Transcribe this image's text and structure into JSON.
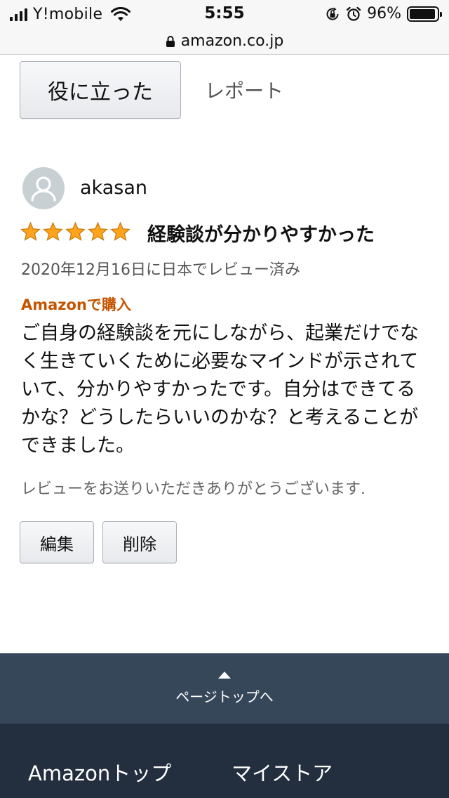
{
  "status_bar": {
    "carrier": "Y!mobile",
    "time": "5:55",
    "battery_percent": "96%",
    "battery_level": 0.96,
    "icons": [
      "signal-icon",
      "wifi-icon",
      "orientation-lock-icon",
      "alarm-icon",
      "battery-icon"
    ]
  },
  "browser": {
    "url": "amazon.co.jp",
    "icons": [
      "lock-icon"
    ]
  },
  "helpful": {
    "button_label": "役に立った",
    "report_label": "レポート"
  },
  "review": {
    "reviewer": "akasan",
    "rating": 5,
    "rating_max": 5,
    "title": "経験談が分かりやすかった",
    "date": "2020年12月16日に日本でレビュー済み",
    "verified": "Amazonで購入",
    "body": "ご自身の経験談を元にしながら、起業だけでなく生きていくために必要なマインドが示されていて、分かりやすかったです。自分はできてるかな？どうしたらいいのかな？と考えることができました。",
    "thanks": "レビューをお送りいただきありがとうございます.",
    "edit_label": "編集",
    "delete_label": "削除"
  },
  "back_to_top": {
    "label": "ページトップへ"
  },
  "footer": {
    "links": [
      "Amazonトップ",
      "マイストア"
    ]
  },
  "colors": {
    "star": "#ffa41c",
    "verified": "#c45500",
    "back_to_top_bg": "#37475a",
    "footer_bg": "#232f3e"
  }
}
